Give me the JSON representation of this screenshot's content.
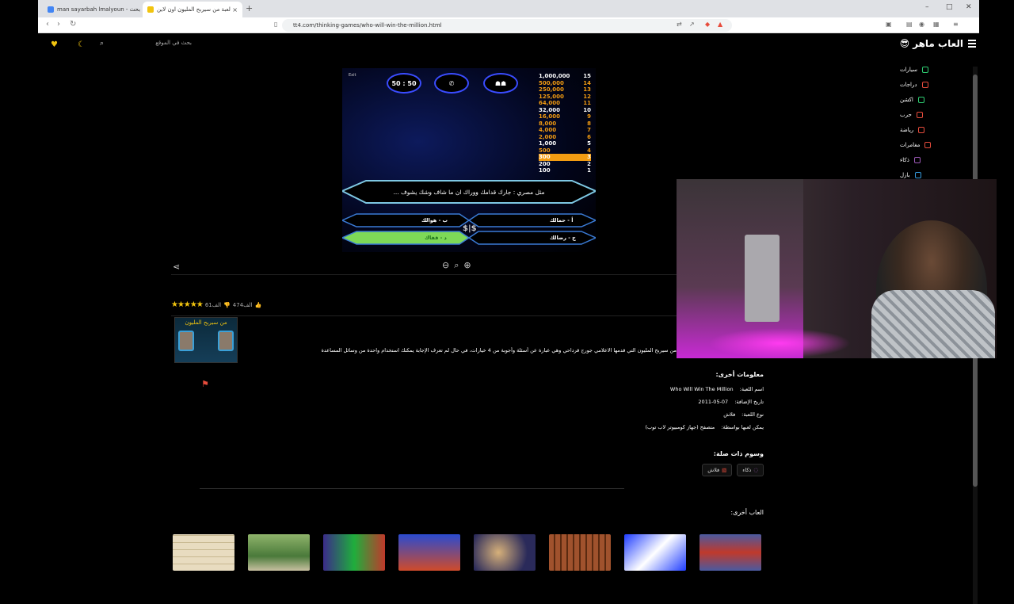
{
  "browser": {
    "tabs": [
      {
        "title": "man sayarbah lmalyoun - بحث Goog"
      },
      {
        "title": "لعبة من سيربح المليون اون لاين"
      }
    ],
    "url": "tt4.com/thinking-games/who-will-win-the-million.html"
  },
  "site": {
    "brand": "العاب ماهر",
    "search_placeholder": "بحث في الموقع",
    "nav": [
      {
        "label": "سيارات",
        "color": "#2ecc71"
      },
      {
        "label": "دراجات",
        "color": "#e74c3c"
      },
      {
        "label": "اكشن",
        "color": "#2ecc71"
      },
      {
        "label": "حرب",
        "color": "#e74c3c"
      },
      {
        "label": "رياضة",
        "color": "#e74c3c"
      },
      {
        "label": "مغامرات",
        "color": "#e74c3c"
      },
      {
        "label": "ذكاء",
        "color": "#9b59b6"
      },
      {
        "label": "بازل",
        "color": "#3498db"
      }
    ]
  },
  "game": {
    "exit_label": "Exit",
    "lifelines": [
      "50 : 50",
      "",
      ""
    ],
    "ladder": [
      {
        "n": "15",
        "v": "1,000,000",
        "tier": "white"
      },
      {
        "n": "14",
        "v": "500,000",
        "tier": ""
      },
      {
        "n": "13",
        "v": "250,000",
        "tier": ""
      },
      {
        "n": "12",
        "v": "125,000",
        "tier": ""
      },
      {
        "n": "11",
        "v": "64,000",
        "tier": ""
      },
      {
        "n": "10",
        "v": "32,000",
        "tier": "white"
      },
      {
        "n": "9",
        "v": "16,000",
        "tier": ""
      },
      {
        "n": "8",
        "v": "8,000",
        "tier": ""
      },
      {
        "n": "7",
        "v": "4,000",
        "tier": ""
      },
      {
        "n": "6",
        "v": "2,000",
        "tier": ""
      },
      {
        "n": "5",
        "v": "1,000",
        "tier": "white"
      },
      {
        "n": "4",
        "v": "500",
        "tier": ""
      },
      {
        "n": "3",
        "v": "300",
        "tier": "hl"
      },
      {
        "n": "2",
        "v": "200",
        "tier": "white"
      },
      {
        "n": "1",
        "v": "100",
        "tier": "white"
      }
    ],
    "question": "مثل مصري : جارك قدامك ووراك ان ما شاف وشك يشوف ...",
    "answers": {
      "a": "أ - حمالك",
      "b": "ب - هوالك",
      "c": "ج - رضالك",
      "d": "د - قفاك"
    },
    "dollar": "$|$"
  },
  "stats": {
    "likes": "474الف",
    "dislikes": "61الف"
  },
  "thumb_title": "من سيربح المليون",
  "description": "من سيربح المليون التي قدمها الاعلامي جورج قرداحي وهي عبارة عن أسئلة وأجوبة من 4 خيارات، في حال لم تعرف الإجابة يمكنك استخدام واحدة من وسائل المساعدة",
  "info": {
    "heading": "معلومات أخرى:",
    "rows": [
      {
        "k": "اسم اللعبة:",
        "v": "Who Will Win The Million"
      },
      {
        "k": "تاريخ الإضافة:",
        "v": "2011-05-07"
      },
      {
        "k": "نوع اللعبة:",
        "v": "فلاش"
      },
      {
        "k": "يمكن لعبها بواسطة:",
        "v": "متصفح (جهاز كومبيوتر لاب توب)"
      }
    ]
  },
  "tags": {
    "heading": "وسوم ذات صلة:",
    "items": [
      "ذكاء",
      "فلاش"
    ]
  },
  "more_heading": "العاب أخرى:"
}
